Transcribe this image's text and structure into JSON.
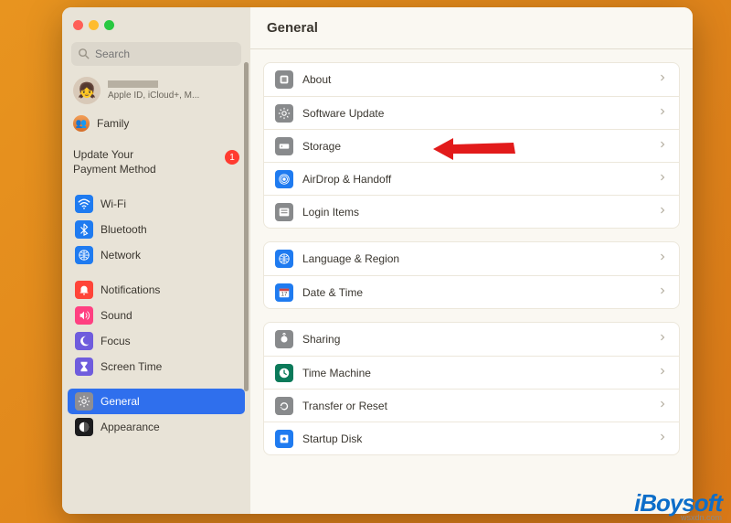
{
  "search": {
    "placeholder": "Search"
  },
  "profile": {
    "subtitle": "Apple ID, iCloud+, M..."
  },
  "family": {
    "label": "Family"
  },
  "payment": {
    "line1": "Update Your",
    "line2": "Payment Method",
    "badge": "1"
  },
  "sidebar": {
    "items": [
      {
        "label": "Wi-Fi",
        "bg": "#1f7bf0",
        "icon": "wifi"
      },
      {
        "label": "Bluetooth",
        "bg": "#1f7bf0",
        "icon": "bt"
      },
      {
        "label": "Network",
        "bg": "#1f7bf0",
        "icon": "globe"
      },
      {
        "label": "Notifications",
        "bg": "#ff4438",
        "icon": "bell"
      },
      {
        "label": "Sound",
        "bg": "#ff4081",
        "icon": "sound"
      },
      {
        "label": "Focus",
        "bg": "#6f5cdd",
        "icon": "moon"
      },
      {
        "label": "Screen Time",
        "bg": "#6f5cdd",
        "icon": "hourglass"
      },
      {
        "label": "General",
        "bg": "#8e8e93",
        "icon": "gear",
        "selected": true
      },
      {
        "label": "Appearance",
        "bg": "#1c1c1e",
        "icon": "appearance"
      }
    ]
  },
  "header": {
    "title": "General"
  },
  "groups": [
    {
      "rows": [
        {
          "label": "About",
          "bg": "#888a8c",
          "icon": "info"
        },
        {
          "label": "Software Update",
          "bg": "#888a8c",
          "icon": "gear"
        },
        {
          "label": "Storage",
          "bg": "#888a8c",
          "icon": "storage"
        },
        {
          "label": "AirDrop & Handoff",
          "bg": "#1f7bf0",
          "icon": "airdrop"
        },
        {
          "label": "Login Items",
          "bg": "#888a8c",
          "icon": "login"
        }
      ]
    },
    {
      "rows": [
        {
          "label": "Language & Region",
          "bg": "#1f7bf0",
          "icon": "globe"
        },
        {
          "label": "Date & Time",
          "bg": "#1f7bf0",
          "icon": "calendar"
        }
      ]
    },
    {
      "rows": [
        {
          "label": "Sharing",
          "bg": "#888a8c",
          "icon": "share"
        },
        {
          "label": "Time Machine",
          "bg": "#0b7a5a",
          "icon": "tm"
        },
        {
          "label": "Transfer or Reset",
          "bg": "#888a8c",
          "icon": "reset"
        },
        {
          "label": "Startup Disk",
          "bg": "#1f7bf0",
          "icon": "disk"
        }
      ]
    }
  ],
  "watermark": "iBoysoft",
  "footer": "wsxdn.com"
}
